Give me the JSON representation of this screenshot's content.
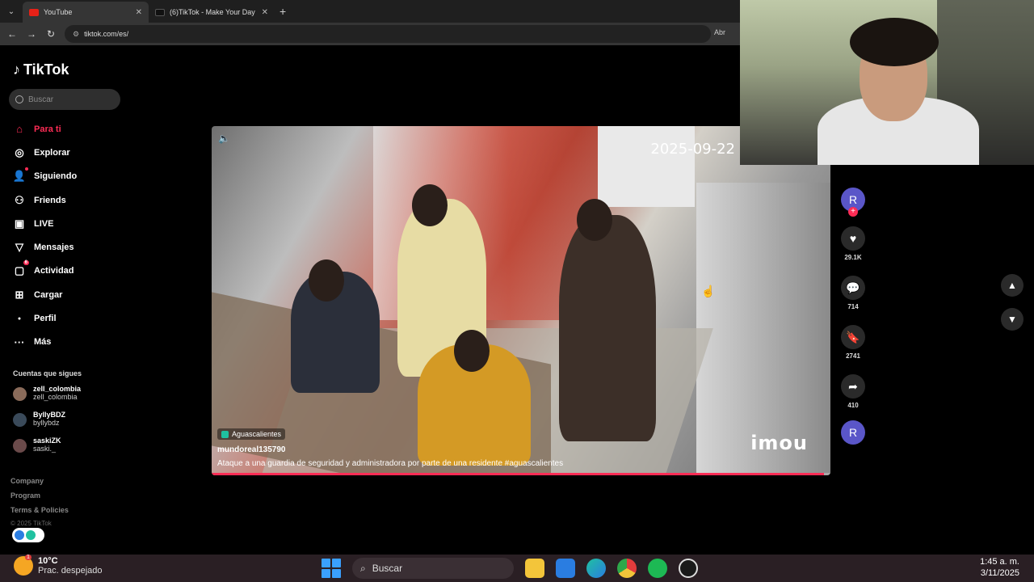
{
  "browser": {
    "tabs": [
      {
        "label": "YouTube",
        "active": true
      },
      {
        "label": "(6)TikTok - Make Your Day",
        "active": false
      }
    ],
    "url": "tiktok.com/es/",
    "right_text": "Abr"
  },
  "tiktok": {
    "logo": "TikTok",
    "search_placeholder": "Buscar",
    "nav": [
      {
        "label": "Para ti",
        "icon": "home-icon",
        "active": true
      },
      {
        "label": "Explorar",
        "icon": "compass-icon"
      },
      {
        "label": "Siguiendo",
        "icon": "following-icon"
      },
      {
        "label": "Friends",
        "icon": "friends-icon"
      },
      {
        "label": "LIVE",
        "icon": "live-icon"
      },
      {
        "label": "Mensajes",
        "icon": "messages-icon"
      },
      {
        "label": "Actividad",
        "icon": "activity-icon",
        "badge": "6"
      },
      {
        "label": "Cargar",
        "icon": "upload-icon"
      },
      {
        "label": "Perfil",
        "icon": "profile-icon"
      },
      {
        "label": "Más",
        "icon": "more-icon"
      }
    ],
    "following_title": "Cuentas que sigues",
    "following": [
      {
        "name": "zell_colombia",
        "handle": "zell_colombia"
      },
      {
        "name": "ByllyBDZ",
        "handle": "byllybdz"
      },
      {
        "name": "saskiZK",
        "handle": "saski._"
      }
    ],
    "footer": [
      "Company",
      "Program",
      "Terms & Policies"
    ],
    "copyright": "© 2025 TikTok"
  },
  "video": {
    "timestamp": "2025-09-22",
    "watermark": "imou",
    "location": "Aguascalientes",
    "author": "mundoreal135790",
    "caption": "Ataque a una guardia de seguridad y administradora por parte de una residente #aguascalientes",
    "progress": 0.99,
    "accent": "#fe2c55"
  },
  "actions": {
    "avatar_letter": "R",
    "likes": "29.1K",
    "comments": "714",
    "saves": "2741",
    "shares": "410",
    "disc_letter": "R"
  },
  "taskbar": {
    "temp": "10°C",
    "weather": "Prac. despejado",
    "weather_badge": "1",
    "search": "Buscar",
    "time": "1:45 a. m.",
    "date": "3/11/2025"
  }
}
